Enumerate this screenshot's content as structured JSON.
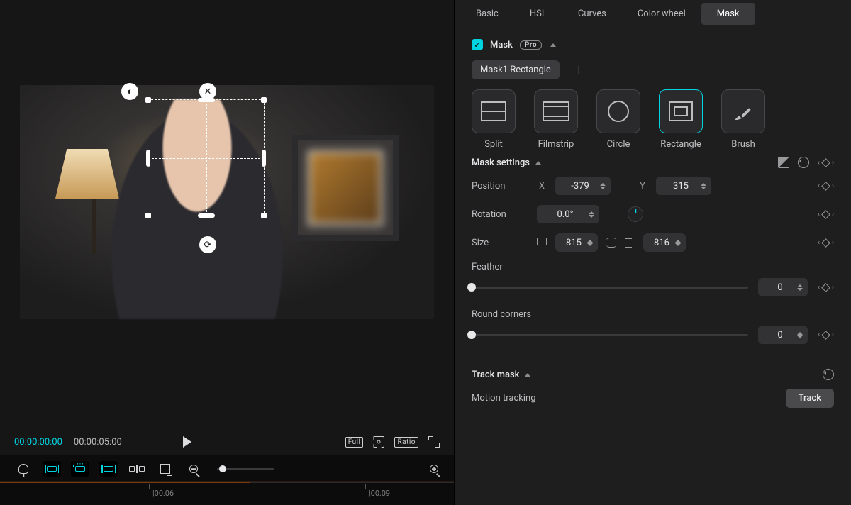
{
  "tabs": {
    "basic": "Basic",
    "hsl": "HSL",
    "curves": "Curves",
    "color_wheel": "Color wheel",
    "mask": "Mask",
    "active": "mask"
  },
  "mask_panel": {
    "title": "Mask",
    "pro_badge": "Pro",
    "mask_chip": "Mask1 Rectangle",
    "shapes": {
      "split": "Split",
      "filmstrip": "Filmstrip",
      "circle": "Circle",
      "rectangle": "Rectangle",
      "brush": "Brush",
      "active": "rectangle"
    },
    "settings_title": "Mask settings",
    "position_label": "Position",
    "position_x_label": "X",
    "position_x_value": "-379",
    "position_y_label": "Y",
    "position_y_value": "315",
    "rotation_label": "Rotation",
    "rotation_value": "0.0°",
    "size_label": "Size",
    "size_w_value": "815",
    "size_h_value": "816",
    "feather_label": "Feather",
    "feather_value": "0",
    "round_label": "Round corners",
    "round_value": "0",
    "track_title": "Track mask",
    "motion_label": "Motion tracking",
    "track_button": "Track"
  },
  "transport": {
    "current": "00:00:00:00",
    "total": "00:00:05:00",
    "full_label": "Full",
    "ratio_label": "Ratio"
  },
  "timeline": {
    "label1": "|00:06",
    "label2": "|00:09"
  }
}
